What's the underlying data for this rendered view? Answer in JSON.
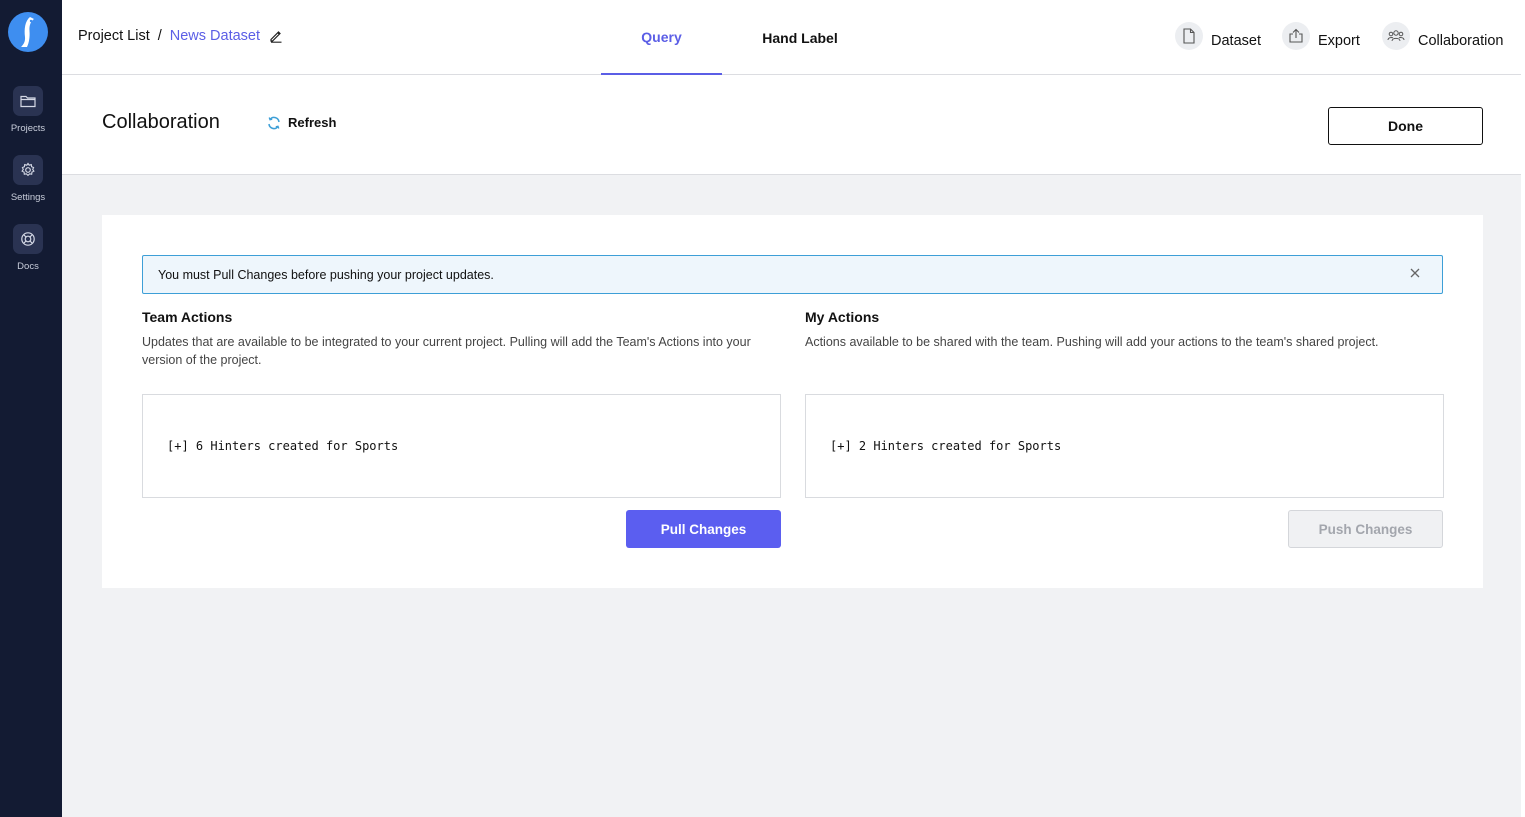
{
  "sidebar": {
    "logo_icon": "penguin-logo-icon",
    "items": [
      {
        "label": "Projects",
        "icon": "folder-icon"
      },
      {
        "label": "Settings",
        "icon": "gear-icon"
      },
      {
        "label": "Docs",
        "icon": "lifebuoy-icon"
      }
    ]
  },
  "header": {
    "breadcrumb_root": "Project List",
    "breadcrumb_separator": "/",
    "breadcrumb_current": "News Dataset",
    "tabs": [
      {
        "label": "Query",
        "active": true
      },
      {
        "label": "Hand Label",
        "active": false
      }
    ],
    "actions": [
      {
        "label": "Dataset",
        "icon": "document-icon"
      },
      {
        "label": "Export",
        "icon": "export-icon"
      },
      {
        "label": "Collaboration",
        "icon": "users-icon"
      }
    ]
  },
  "subheader": {
    "title": "Collaboration",
    "refresh_label": "Refresh",
    "done_label": "Done"
  },
  "alert": {
    "message": "You must Pull Changes before pushing your project updates."
  },
  "team": {
    "title": "Team Actions",
    "description_line1": "Updates that are available to be integrated to your current project. Pulling will add the Team's Actions into your",
    "description_line2": "version of the project.",
    "change": "[+] 6 Hinters created for Sports",
    "button_label": "Pull Changes"
  },
  "mine": {
    "title": "My Actions",
    "description": "Actions available to be shared with the team. Pushing will add your actions to the team's shared project.",
    "change": "[+] 2 Hinters created for Sports",
    "button_label": "Push Changes",
    "button_disabled": true
  },
  "colors": {
    "sidebar_bg": "#131b33",
    "accent": "#5b5ef0",
    "alert_border": "#3d9fd7",
    "alert_bg": "#eef6fc"
  }
}
